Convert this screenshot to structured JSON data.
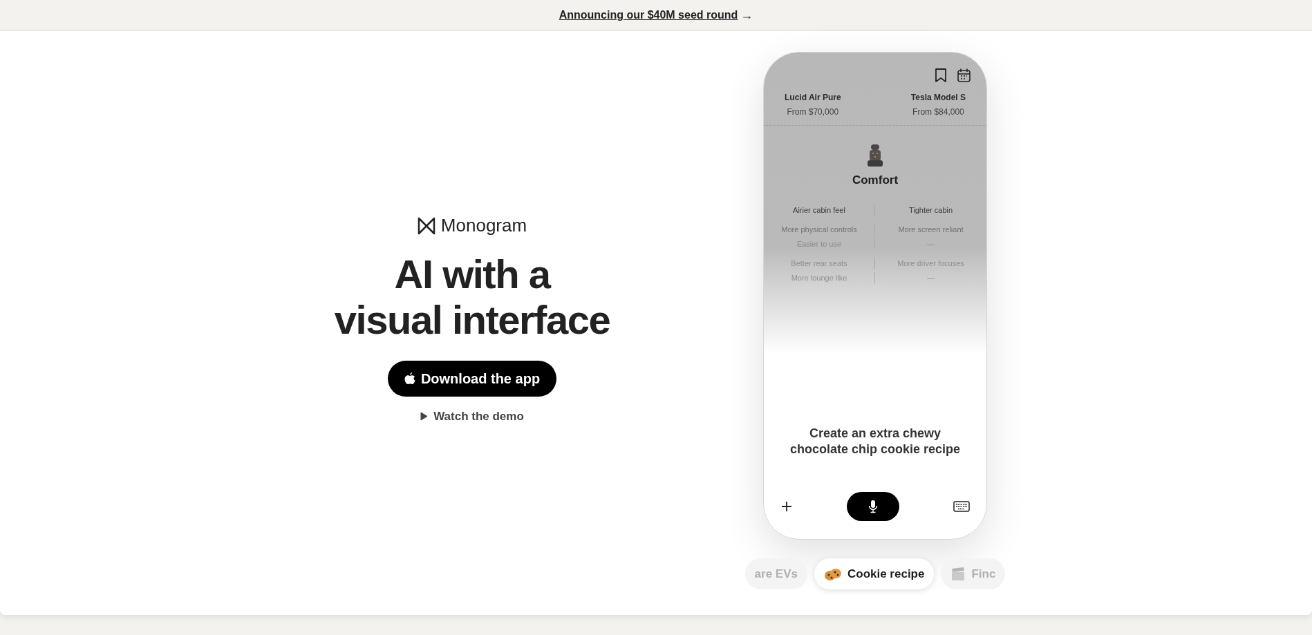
{
  "banner": {
    "link": "Announcing our $40M seed round",
    "arrow": "→"
  },
  "hero": {
    "brand": "Monogram",
    "heading_lines": [
      "AI with a",
      "visual interface"
    ],
    "primary_button": "Download the app",
    "secondary_link": "Watch the demo"
  },
  "phone": {
    "cars": [
      {
        "name": "Lucid Air Pure",
        "price": "From $70,000"
      },
      {
        "name": "Tesla Model S",
        "price": "From $84,000"
      }
    ],
    "section_title": "Comfort",
    "comparison": [
      {
        "left": "Airier cabin feel",
        "right": "Tighter cabin"
      },
      {
        "left": "More physical controls",
        "right": "More screen reliant"
      },
      {
        "left": "Easier to use",
        "right": "—"
      },
      {
        "left": "Better rear seats",
        "right": "More driver focuses"
      },
      {
        "left": "More lounge like",
        "right": "—"
      }
    ],
    "prompt": "Create an extra chewy chocolate chip cookie recipe"
  },
  "chips": [
    {
      "label": "are EVs",
      "kind": "none",
      "selected": false
    },
    {
      "label": "Cookie recipe",
      "kind": "cookie",
      "selected": true
    },
    {
      "label": "Finc",
      "kind": "clapper",
      "selected": false
    }
  ]
}
